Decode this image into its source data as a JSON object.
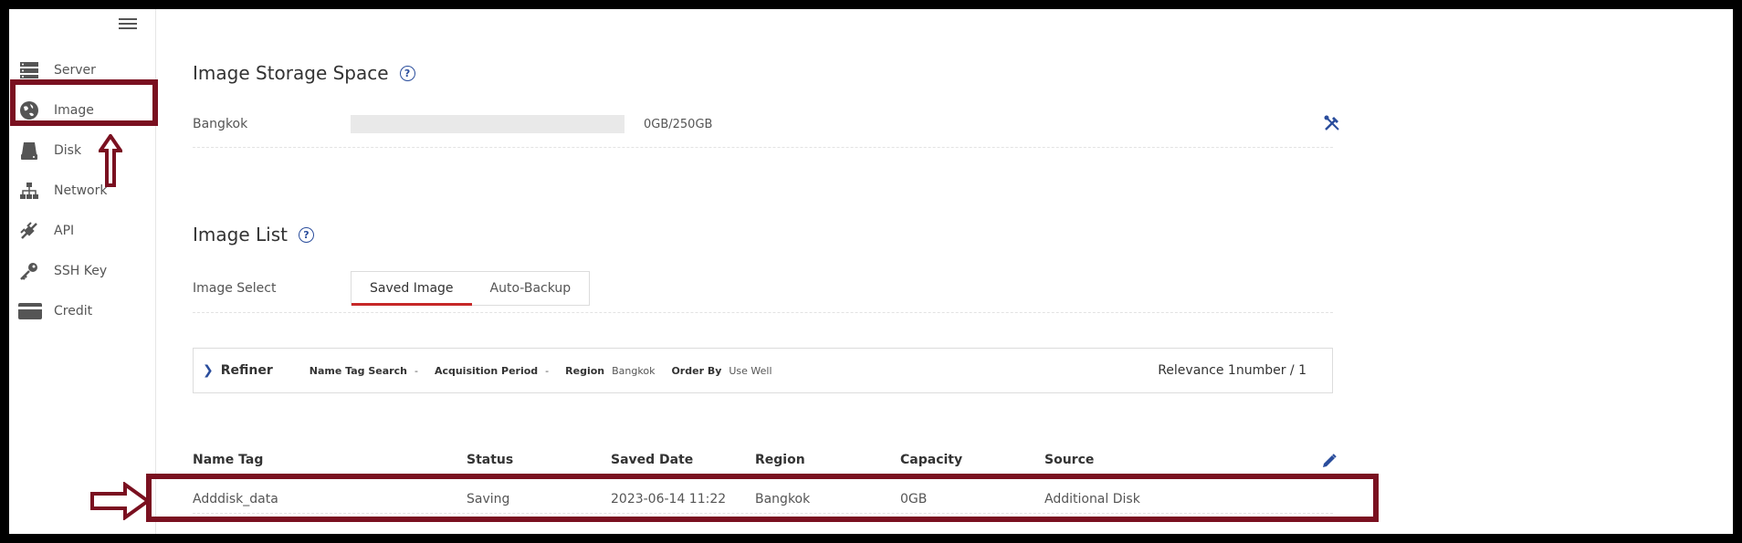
{
  "sidebar": {
    "items": [
      {
        "label": "Server",
        "icon": "server-icon"
      },
      {
        "label": "Image",
        "icon": "image-globe-icon"
      },
      {
        "label": "Disk",
        "icon": "disk-icon"
      },
      {
        "label": "Network",
        "icon": "network-icon"
      },
      {
        "label": "API",
        "icon": "api-icon"
      },
      {
        "label": "SSH Key",
        "icon": "key-icon"
      },
      {
        "label": "Credit",
        "icon": "credit-card-icon"
      }
    ]
  },
  "storage": {
    "title": "Image Storage Space",
    "region": "Bangkok",
    "usage_text": "0GB/250GB",
    "usage_fraction": 0
  },
  "image_list": {
    "title": "Image List",
    "select_label": "Image Select",
    "tabs": [
      "Saved Image",
      "Auto-Backup"
    ],
    "active_tab": "Saved Image"
  },
  "refiner": {
    "title": "Refiner",
    "filters": [
      {
        "label": "Name Tag Search",
        "value": "-"
      },
      {
        "label": "Acquisition Period",
        "value": "-"
      },
      {
        "label": "Region",
        "value": "Bangkok"
      },
      {
        "label": "Order By",
        "value": "Use Well"
      }
    ],
    "relevance": "Relevance 1number / 1"
  },
  "table": {
    "headers": [
      "Name Tag",
      "Status",
      "Saved Date",
      "Region",
      "Capacity",
      "Source"
    ],
    "rows": [
      [
        "Adddisk_data",
        "Saving",
        "2023-06-14 11:22",
        "Bangkok",
        "0GB",
        "Additional Disk"
      ]
    ]
  },
  "colors": {
    "accent_blue": "#2a4d9c",
    "active_tab_underline": "#c62828",
    "annotation": "#7a1020"
  }
}
